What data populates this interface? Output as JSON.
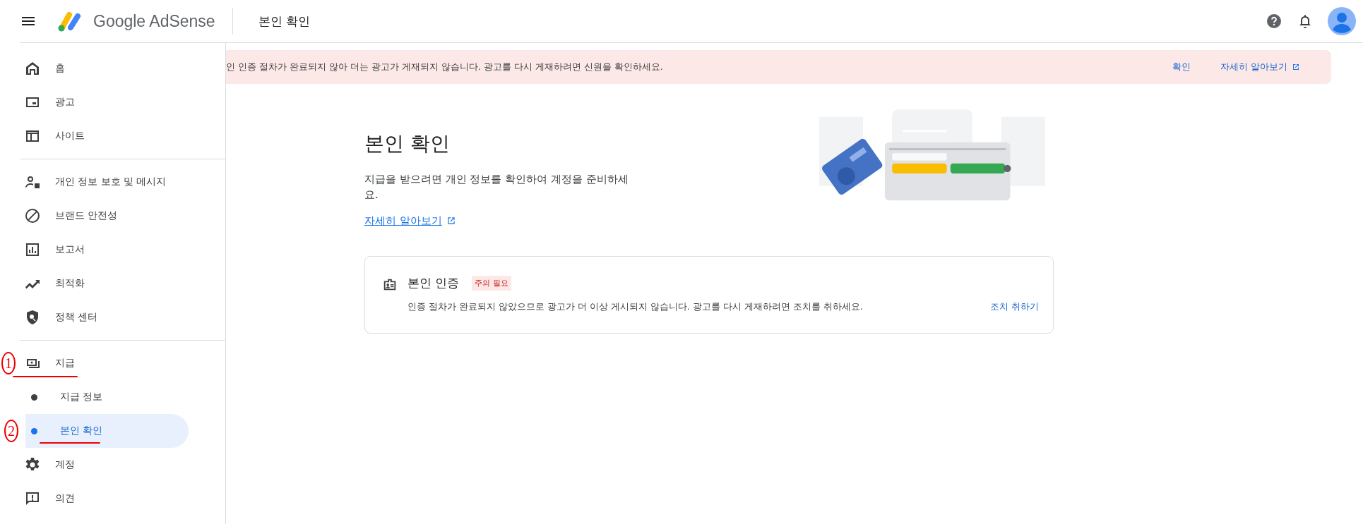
{
  "header": {
    "product": "Google AdSense",
    "page_title": "본인 확인"
  },
  "banner": {
    "message": "인 인증 절차가 완료되지 않아 더는 광고가 게재되지 않습니다. 광고를 다시 게재하려면 신원을 확인하세요.",
    "actions": [
      {
        "label": "확인"
      },
      {
        "label": "자세히 알아보기"
      }
    ]
  },
  "sidebar": {
    "sections": [
      {
        "items": [
          {
            "label": "홈",
            "selected": false
          },
          {
            "label": "광고",
            "selected": false
          },
          {
            "label": "사이트",
            "selected": false
          }
        ]
      },
      {
        "items": [
          {
            "label": "개인 정보 보호 및 메시지",
            "selected": false
          },
          {
            "label": "브랜드 안전성",
            "selected": false
          },
          {
            "label": "보고서",
            "selected": false
          },
          {
            "label": "최적화",
            "selected": false
          },
          {
            "label": "정책 센터",
            "selected": false
          }
        ]
      },
      {
        "items": [
          {
            "label": "지급",
            "selected": false,
            "note": "1",
            "children": [
              {
                "label": "지급 정보",
                "selected": false
              },
              {
                "label": "본인 확인",
                "selected": true,
                "note": "2"
              }
            ]
          },
          {
            "label": "계정",
            "selected": false
          },
          {
            "label": "의견",
            "selected": false
          }
        ]
      }
    ]
  },
  "main": {
    "title": "본인 확인",
    "description": "지급을 받으려면 개인 정보를 확인하여 계정을 준비하세요.",
    "link": {
      "label": "자세히 알아보기"
    },
    "card": {
      "title": "본인 인증",
      "badge": "주의 필요",
      "message": "인증 절차가 완료되지 않았으므로 광고가 더 이상 게시되지 않습니다. 광고를 다시 게재하려면 조치를 취하세요.",
      "action": "조치 취하기"
    }
  }
}
